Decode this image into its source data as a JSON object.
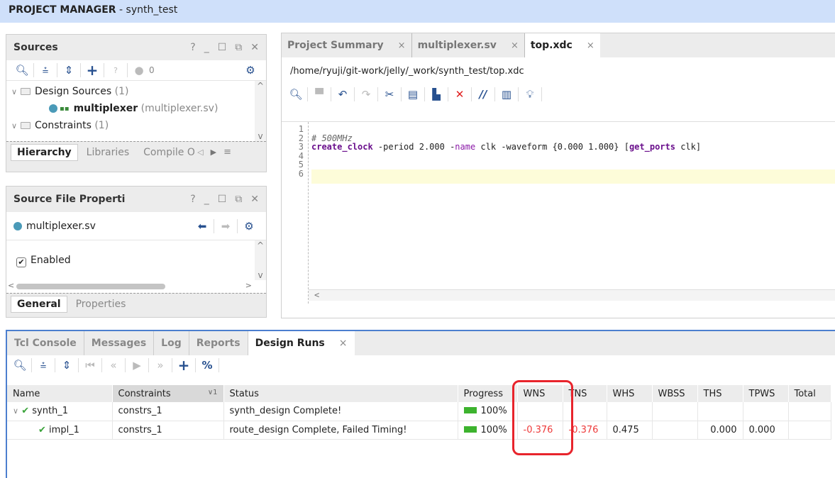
{
  "title": {
    "bold": "PROJECT MANAGER",
    "rest": " - synth_test"
  },
  "window_controls": [
    "?",
    "_",
    "☐",
    "⧉",
    "✕"
  ],
  "sources": {
    "title": "Sources",
    "toolbar": {
      "search": "⚲",
      "collapse": "⇞",
      "expand": "⇕",
      "add": "+",
      "unknown": "?",
      "count": "0",
      "settings": "⚙"
    },
    "tree": [
      {
        "label": "Design Sources",
        "count": "(1)"
      },
      {
        "label": "multiplexer",
        "file": "(multiplexer.sv)"
      },
      {
        "label": "Constraints",
        "count": "(1)"
      }
    ],
    "tabs": [
      "Hierarchy",
      "Libraries",
      "Compile Order"
    ]
  },
  "source_file_properties": {
    "title": "Source File Properti",
    "file": "multiplexer.sv",
    "enabled_label": "Enabled",
    "enabled": true,
    "tabs": [
      "General",
      "Properties"
    ]
  },
  "editor": {
    "tabs": [
      {
        "label": "Project Summary",
        "active": false
      },
      {
        "label": "multiplexer.sv",
        "active": false
      },
      {
        "label": "top.xdc",
        "active": true
      }
    ],
    "path": "/home/ryuji/git-work/jelly/_work/synth_test/top.xdc",
    "line_numbers": [
      "1",
      "2",
      "3",
      "4",
      "5",
      "6"
    ],
    "code": {
      "line2": "# 500MHz",
      "line3": {
        "cmd": "create_clock",
        "a": " -period 2.000 -",
        "name_opt": "name",
        "b": " clk -waveform {0.000 1.000} [",
        "get": "get_ports",
        "c": " clk]"
      }
    }
  },
  "design_runs": {
    "tabs": [
      "Tcl Console",
      "Messages",
      "Log",
      "Reports",
      "Design Runs"
    ],
    "active_tab": "Design Runs",
    "columns": [
      "Name",
      "Constraints",
      "Status",
      "Progress",
      "WNS",
      "TNS",
      "WHS",
      "WBSS",
      "THS",
      "TPWS",
      "Total"
    ],
    "sort_indicator": "∨1",
    "rows": [
      {
        "name": "synth_1",
        "constraints": "constrs_1",
        "status": "synth_design Complete!",
        "progress": "100%",
        "wns": "",
        "tns": "",
        "whs": "",
        "wbss": "",
        "ths": "",
        "tpws": "",
        "total": ""
      },
      {
        "name": "impl_1",
        "constraints": "constrs_1",
        "status": "route_design Complete, Failed Timing!",
        "progress": "100%",
        "wns": "-0.376",
        "tns": "-0.376",
        "whs": "0.475",
        "wbss": "",
        "ths": "0.000",
        "tpws": "0.000",
        "total": ""
      }
    ]
  },
  "colors": {
    "accent": "#4c7fcf",
    "title_bg": "#cfe0fa",
    "negative": "#ee3b3b",
    "progress": "#3db32e",
    "annotation": "#e8242c"
  }
}
